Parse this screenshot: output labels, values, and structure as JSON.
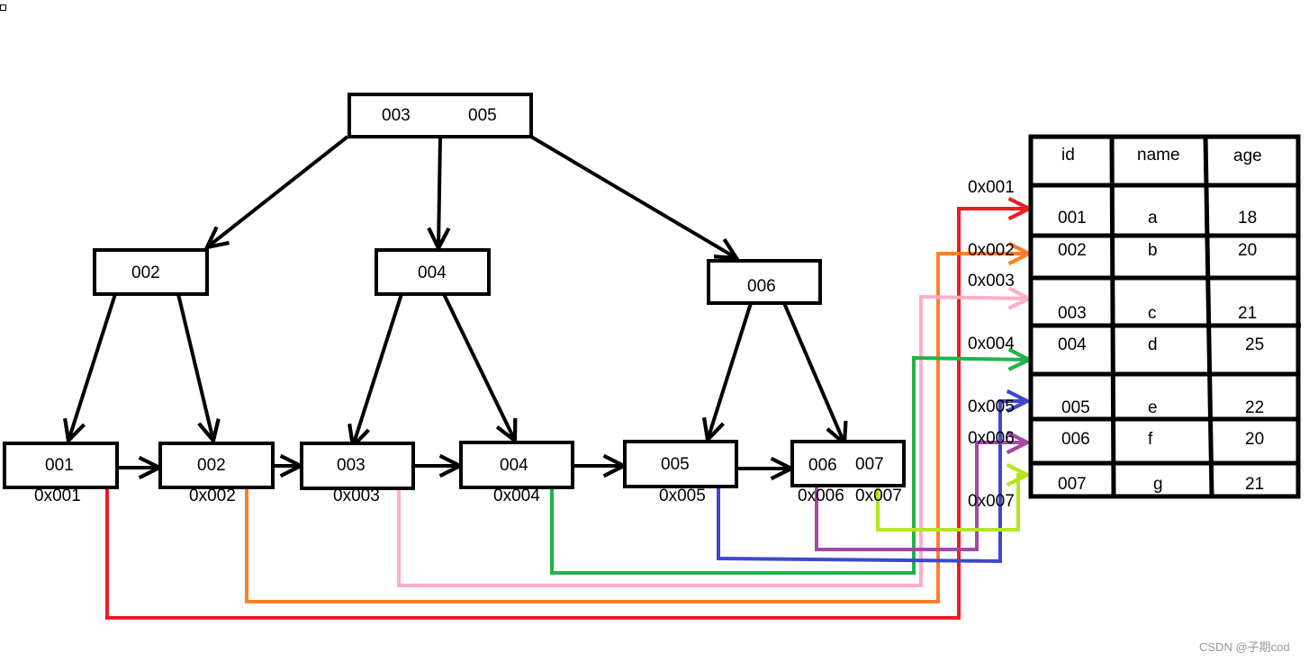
{
  "root": {
    "keys": [
      "003",
      "005"
    ]
  },
  "internal": [
    {
      "keys": [
        "002"
      ]
    },
    {
      "keys": [
        "004"
      ]
    },
    {
      "keys": [
        "006"
      ]
    }
  ],
  "leaves": [
    {
      "keys": [
        "001"
      ],
      "addresses": [
        "0x001"
      ]
    },
    {
      "keys": [
        "002"
      ],
      "addresses": [
        "0x002"
      ]
    },
    {
      "keys": [
        "003"
      ],
      "addresses": [
        "0x003"
      ]
    },
    {
      "keys": [
        "004"
      ],
      "addresses": [
        "0x004"
      ]
    },
    {
      "keys": [
        "005"
      ],
      "addresses": [
        "0x005"
      ]
    },
    {
      "keys": [
        "006",
        "007"
      ],
      "addresses": [
        "0x006",
        "0x007"
      ]
    }
  ],
  "table": {
    "headers": [
      "id",
      "name",
      "age"
    ],
    "rows": [
      {
        "address": "0x001",
        "id": "001",
        "name": "a",
        "age": "18"
      },
      {
        "address": "0x002",
        "id": "002",
        "name": "b",
        "age": "20"
      },
      {
        "address": "0x003",
        "id": "003",
        "name": "c",
        "age": "21"
      },
      {
        "address": "0x004",
        "id": "004",
        "name": "d",
        "age": "25"
      },
      {
        "address": "0x005",
        "id": "005",
        "name": "e",
        "age": "22"
      },
      {
        "address": "0x006",
        "id": "006",
        "name": "f",
        "age": "20"
      },
      {
        "address": "0x007",
        "id": "007",
        "name": "g",
        "age": "21"
      }
    ]
  },
  "pointer_colors": [
    "#ed1c24",
    "#ff7f27",
    "#ffaec9",
    "#22b14c",
    "#3f48cc",
    "#a349a4",
    "#b5e61d"
  ],
  "watermark": "CSDN @子期cod"
}
